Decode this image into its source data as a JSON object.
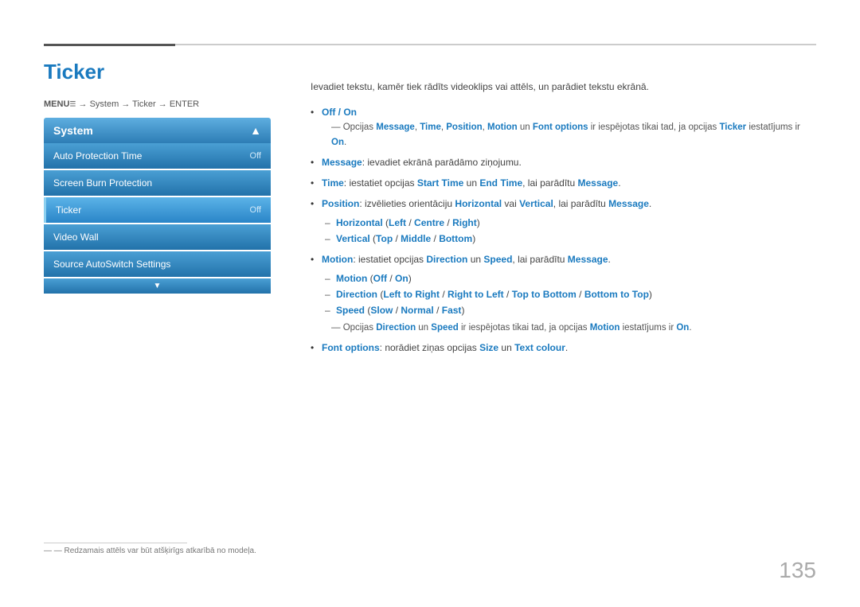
{
  "page": {
    "title": "Ticker",
    "page_number": "135"
  },
  "menu_path": {
    "text": "MENU",
    "icon": "☰",
    "path": "→ System → Ticker → ENTER"
  },
  "system_panel": {
    "header": "System",
    "arrow_up": "▲",
    "arrow_down": "▼",
    "items": [
      {
        "label": "Auto Protection Time",
        "value": "Off",
        "active": false
      },
      {
        "label": "Screen Burn Protection",
        "value": "",
        "active": false
      },
      {
        "label": "Ticker",
        "value": "Off",
        "active": true
      },
      {
        "label": "Video Wall",
        "value": "",
        "active": false
      },
      {
        "label": "Source AutoSwitch Settings",
        "value": "",
        "active": false
      }
    ]
  },
  "content": {
    "intro": "Ievadiet tekstu, kamēr tiek rādīts videoklips vai attēls, un parādiet tekstu ekrānā.",
    "bullets": [
      {
        "id": "off_on",
        "text_before": "",
        "bold": "Off / On",
        "text_after": "",
        "subnote": "Opcijas Message, Time, Position, Motion un Font options ir iespējotas tikai tad, ja opcijas Ticker iestatījums ir On.",
        "subnote_has_bold": true
      },
      {
        "id": "message",
        "bold": "Message",
        "text_after": ": ievadiet ekrānā parādāmo ziņojumu."
      },
      {
        "id": "time",
        "bold": "Time",
        "text_after": ": iestatiet opcijas Start Time un End Time, lai parādītu Message."
      },
      {
        "id": "position",
        "bold": "Position",
        "text_after": ": izvēlieties orientāciju Horizontal vai Vertical, lai parādītu Message.",
        "sub": [
          "Horizontal (Left / Centre / Right)",
          "Vertical (Top / Middle / Bottom)"
        ]
      },
      {
        "id": "motion",
        "bold": "Motion",
        "text_after": ": iestatiet opcijas Direction un Speed, lai parādītu Message.",
        "sub": [
          "Motion (Off / On)",
          "Direction (Left to Right / Right to Left / Top to Bottom / Bottom to Top)",
          "Speed (Slow / Normal / Fast)"
        ],
        "subnote2": "Opcijas Direction un Speed ir iespējotas tikai tad, ja opcijas Motion iestatījums ir On.",
        "subnote2_has_bold": true
      },
      {
        "id": "font_options",
        "bold": "Font options",
        "text_after": ": norādiet ziņas opcijas Size un Text colour."
      }
    ]
  },
  "bottom_note": "— Redzamais attēls var būt atšķirīgs atkarībā no modeļa.",
  "colors": {
    "accent_blue": "#1a7abf",
    "panel_gradient_start": "#5eaee0",
    "panel_gradient_end": "#2d7db5"
  }
}
